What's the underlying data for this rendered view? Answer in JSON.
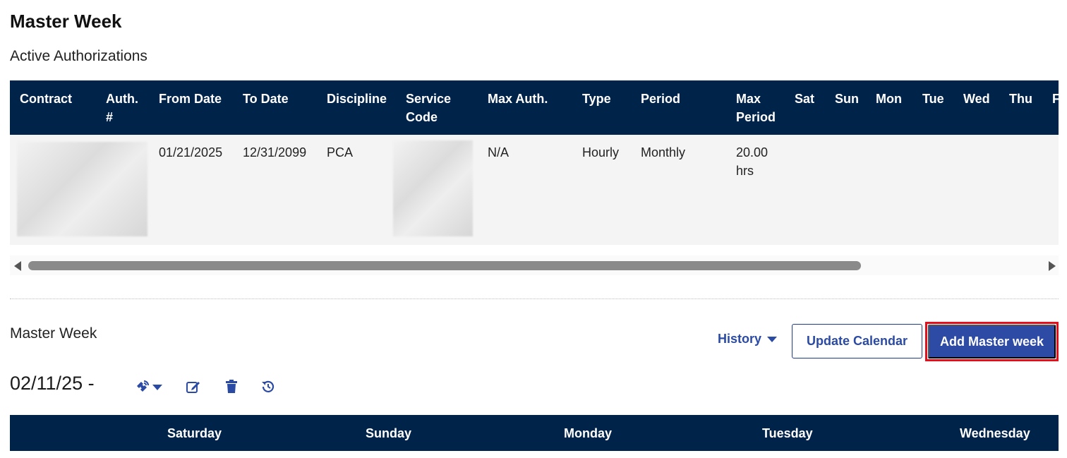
{
  "page": {
    "title": "Master Week",
    "subtitle": "Active Authorizations"
  },
  "auth_table": {
    "headers": {
      "contract": "Contract",
      "auth_line1": "Auth.",
      "auth_line2": "#",
      "from_date": "From Date",
      "to_date": "To Date",
      "discipline": "Discipline",
      "service_code_line1": "Service",
      "service_code_line2": "Code",
      "max_auth": "Max Auth.",
      "type": "Type",
      "period": "Period",
      "max_period_line1": "Max",
      "max_period_line2": "Period",
      "sat": "Sat",
      "sun": "Sun",
      "mon": "Mon",
      "tue": "Tue",
      "wed": "Wed",
      "thu": "Thu",
      "fri_partial": "F"
    },
    "rows": [
      {
        "from_date": "01/21/2025",
        "to_date": "12/31/2099",
        "discipline": "PCA",
        "max_auth": "N/A",
        "type": "Hourly",
        "period": "Monthly",
        "max_period_line1": "20.00",
        "max_period_line2": "hrs"
      }
    ]
  },
  "master_week": {
    "label": "Master Week",
    "history_label": "History",
    "update_calendar_label": "Update Calendar",
    "add_master_week_label": "Add Master week",
    "date_range": "02/11/25 -",
    "highlight_color": "#e0101c"
  },
  "week_table": {
    "days": [
      "Saturday",
      "Sunday",
      "Monday",
      "Tuesday",
      "Wednesday"
    ]
  },
  "colors": {
    "header_bg": "#00234a",
    "accent": "#2b4aa3",
    "primary_button": "#2d4aa5"
  }
}
